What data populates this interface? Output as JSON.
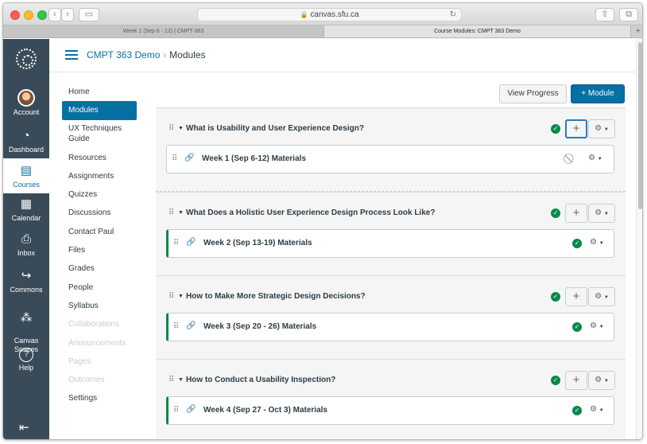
{
  "browser": {
    "url": "canvas.sfu.ca",
    "tabs": [
      {
        "label": "Week 1 (Sep 6 - 12) | CMPT-363"
      },
      {
        "label": "Course Modules: CMPT 363 Demo"
      }
    ],
    "tab_add": "+"
  },
  "global_nav": {
    "items": [
      {
        "label": "Account",
        "icon": "avatar"
      },
      {
        "label": "Dashboard",
        "icon": "dashboard-icon"
      },
      {
        "label": "Courses",
        "icon": "courses-icon"
      },
      {
        "label": "Calendar",
        "icon": "calendar-icon"
      },
      {
        "label": "Inbox",
        "icon": "inbox-icon"
      },
      {
        "label": "Commons",
        "icon": "commons-icon"
      },
      {
        "label": "Canvas\nSpaces",
        "icon": "spaces-icon"
      },
      {
        "label": "Help",
        "icon": "help-icon"
      }
    ]
  },
  "header": {
    "course": "CMPT 363 Demo",
    "separator": "›",
    "current": "Modules"
  },
  "course_nav": {
    "items": [
      {
        "label": "Home"
      },
      {
        "label": "Modules"
      },
      {
        "label": "UX Techniques Guide"
      },
      {
        "label": "Resources"
      },
      {
        "label": "Assignments"
      },
      {
        "label": "Quizzes"
      },
      {
        "label": "Discussions"
      },
      {
        "label": "Contact Paul"
      },
      {
        "label": "Files"
      },
      {
        "label": "Grades"
      },
      {
        "label": "People"
      },
      {
        "label": "Syllabus"
      },
      {
        "label": "Collaborations"
      },
      {
        "label": "Announcements"
      },
      {
        "label": "Pages"
      },
      {
        "label": "Outcomes"
      },
      {
        "label": "Settings"
      }
    ]
  },
  "actions": {
    "view_progress": "View Progress",
    "add_module": "+ Module"
  },
  "modules": [
    {
      "title": "What is Usability and User Experience Design?",
      "item": "Week 1 (Sep 6-12) Materials",
      "item_published": false
    },
    {
      "title": "What Does a Holistic User Experience Design Process Look Like?",
      "item": "Week 2 (Sep 13-19) Materials",
      "item_published": true
    },
    {
      "title": "How to Make More Strategic Design Decisions?",
      "item": "Week 3 (Sep 20 - 26) Materials",
      "item_published": true
    },
    {
      "title": "How to Conduct a Usability Inspection?",
      "item": "Week 4 (Sep 27 - Oct 3) Materials",
      "item_published": true
    }
  ],
  "colors": {
    "brand": "#0770a3",
    "nav_bg": "#394b58",
    "published": "#0b874b"
  }
}
